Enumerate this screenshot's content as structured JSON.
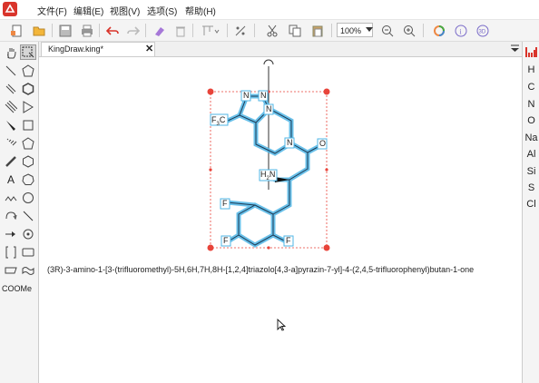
{
  "menubar": {
    "items": [
      {
        "id": "file",
        "label": "文件(F)"
      },
      {
        "id": "edit",
        "label": "编辑(E)"
      },
      {
        "id": "view",
        "label": "视图(V)"
      },
      {
        "id": "options",
        "label": "选项(S)"
      },
      {
        "id": "help",
        "label": "帮助(H)"
      }
    ]
  },
  "toolbar": {
    "icons": [
      "new-doc-icon",
      "open-folder-icon",
      "save-icon",
      "print-icon",
      "undo-icon",
      "redo-icon",
      "eraser-icon",
      "delete-icon",
      "align-icon",
      "mirror-icon",
      "cut-icon",
      "copy-icon",
      "paste-icon",
      "zoom-out-icon",
      "zoom-in-icon",
      "color-ring-icon",
      "info-icon",
      "3d-view-icon"
    ],
    "zoom_value": "100%"
  },
  "tab": {
    "title": "KingDraw.king*",
    "close": "✕"
  },
  "left_tools": {
    "text_tool": "A",
    "cooме_label": "COOMe"
  },
  "right_elements": [
    "H",
    "C",
    "N",
    "O",
    "Na",
    "Al",
    "Si",
    "S",
    "Cl"
  ],
  "molecule": {
    "labels": {
      "f3c_main": "F",
      "f3c_sub": "3",
      "f3c_c": "C",
      "n_top_left": "N",
      "n_top_right": "N",
      "n_bridge": "N",
      "n_piperazine": "N",
      "o": "O",
      "nh2_main": "H",
      "nh2_sub": "2",
      "nh2_n": "N",
      "f_upper": "F",
      "f_lower_left": "F",
      "f_lower_right": "F"
    },
    "iupac_name": "(3R)-3-amino-1-[3-(trifluoromethyl)-5H,6H,7H,8H-[1,2,4]triazolo[4,3-a]pyrazin-7-yl]-4-(2,4,5-trifluorophenyl)butan-1-one"
  },
  "colors": {
    "accent": "#d9342b",
    "bond_highlight": "#4fb6e6",
    "selection_handle": "#e8443a"
  }
}
